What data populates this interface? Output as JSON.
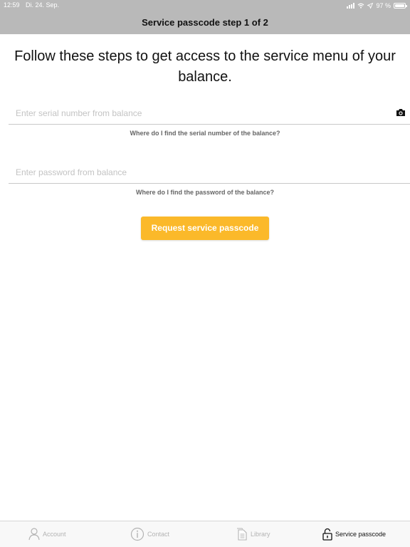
{
  "status_bar": {
    "time": "12:59",
    "date": "Di. 24. Sep.",
    "battery": "97 %"
  },
  "nav": {
    "title": "Service passcode step 1 of 2"
  },
  "intro": "Follow these steps to get access to the service menu of your balance.",
  "serial": {
    "placeholder": "Enter serial number from balance",
    "value": "",
    "help": "Where do I find the serial number of the balance?",
    "scan_icon": "camera-icon"
  },
  "password": {
    "placeholder": "Enter password from balance",
    "value": "",
    "help": "Where do I find the password of the balance?"
  },
  "request_button": "Request service passcode",
  "tabs": [
    {
      "label": "Account",
      "icon": "person-icon",
      "active": false
    },
    {
      "label": "Contact",
      "icon": "info-icon",
      "active": false
    },
    {
      "label": "Library",
      "icon": "document-icon",
      "active": false
    },
    {
      "label": "Service passcode",
      "icon": "unlock-icon",
      "active": true
    }
  ],
  "colors": {
    "header": "#b9b9b9",
    "accent": "#fbb92a",
    "tab_inactive": "#b3b3b3",
    "tab_active": "#111111"
  }
}
